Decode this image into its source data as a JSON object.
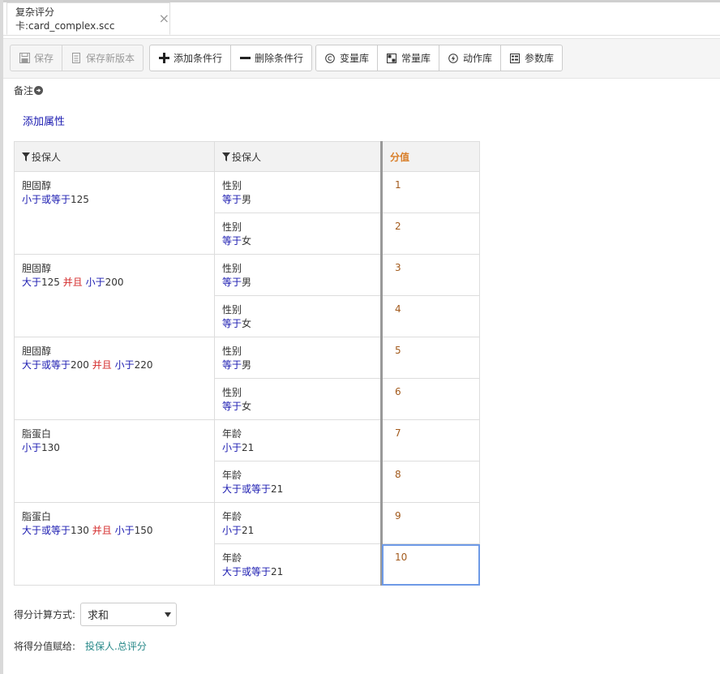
{
  "tab": {
    "title": "复杂评分卡:card_complex.scc",
    "close_glyph": "×"
  },
  "toolbar": {
    "groups": [
      [
        {
          "label": "保存",
          "icon": "save-icon",
          "disabled": true
        },
        {
          "label": "保存新版本",
          "icon": "save-new-version-icon",
          "disabled": true
        }
      ],
      [
        {
          "label": "添加条件行",
          "icon": "plus-icon",
          "disabled": false
        },
        {
          "label": "删除条件行",
          "icon": "minus-icon",
          "disabled": false
        }
      ],
      [
        {
          "label": "变量库",
          "icon": "copyright-icon",
          "disabled": false
        },
        {
          "label": "常量库",
          "icon": "grid-icon",
          "disabled": false
        },
        {
          "label": "动作库",
          "icon": "bolt-icon",
          "disabled": false
        },
        {
          "label": "参数库",
          "icon": "list-icon",
          "disabled": false
        }
      ]
    ]
  },
  "note": {
    "label": "备注"
  },
  "add_attribute": {
    "label": "添加属性"
  },
  "table": {
    "headers": [
      "投保人",
      "投保人",
      "分值"
    ],
    "groups": [
      {
        "attribute": "胆固醇",
        "condition": [
          {
            "t": "op",
            "v": "小于或等于"
          },
          {
            "t": "num",
            "v": "125"
          }
        ],
        "rows": [
          {
            "attribute": "性别",
            "condition": [
              {
                "t": "op",
                "v": "等于"
              },
              {
                "t": "num",
                "v": "男"
              }
            ],
            "score": "1"
          },
          {
            "attribute": "性别",
            "condition": [
              {
                "t": "op",
                "v": "等于"
              },
              {
                "t": "num",
                "v": "女"
              }
            ],
            "score": "2"
          }
        ]
      },
      {
        "attribute": "胆固醇",
        "condition": [
          {
            "t": "op",
            "v": "大于"
          },
          {
            "t": "num",
            "v": "125 "
          },
          {
            "t": "and",
            "v": "并且 "
          },
          {
            "t": "op",
            "v": "小于"
          },
          {
            "t": "num",
            "v": "200"
          }
        ],
        "rows": [
          {
            "attribute": "性别",
            "condition": [
              {
                "t": "op",
                "v": "等于"
              },
              {
                "t": "num",
                "v": "男"
              }
            ],
            "score": "3"
          },
          {
            "attribute": "性别",
            "condition": [
              {
                "t": "op",
                "v": "等于"
              },
              {
                "t": "num",
                "v": "女"
              }
            ],
            "score": "4"
          }
        ]
      },
      {
        "attribute": "胆固醇",
        "condition": [
          {
            "t": "op",
            "v": "大于或等于"
          },
          {
            "t": "num",
            "v": "200 "
          },
          {
            "t": "and",
            "v": "并且 "
          },
          {
            "t": "op",
            "v": "小于"
          },
          {
            "t": "num",
            "v": "220"
          }
        ],
        "rows": [
          {
            "attribute": "性别",
            "condition": [
              {
                "t": "op",
                "v": "等于"
              },
              {
                "t": "num",
                "v": "男"
              }
            ],
            "score": "5"
          },
          {
            "attribute": "性别",
            "condition": [
              {
                "t": "op",
                "v": "等于"
              },
              {
                "t": "num",
                "v": "女"
              }
            ],
            "score": "6"
          }
        ]
      },
      {
        "attribute": "脂蛋白",
        "condition": [
          {
            "t": "op",
            "v": "小于"
          },
          {
            "t": "num",
            "v": "130"
          }
        ],
        "rows": [
          {
            "attribute": "年龄",
            "condition": [
              {
                "t": "op",
                "v": "小于"
              },
              {
                "t": "num",
                "v": "21"
              }
            ],
            "score": "7"
          },
          {
            "attribute": "年龄",
            "condition": [
              {
                "t": "op",
                "v": "大于或等于"
              },
              {
                "t": "num",
                "v": "21"
              }
            ],
            "score": "8"
          }
        ]
      },
      {
        "attribute": "脂蛋白",
        "condition": [
          {
            "t": "op",
            "v": "大于或等于"
          },
          {
            "t": "num",
            "v": "130 "
          },
          {
            "t": "and",
            "v": "并且 "
          },
          {
            "t": "op",
            "v": "小于"
          },
          {
            "t": "num",
            "v": "150"
          }
        ],
        "rows": [
          {
            "attribute": "年龄",
            "condition": [
              {
                "t": "op",
                "v": "小于"
              },
              {
                "t": "num",
                "v": "21"
              }
            ],
            "score": "9"
          },
          {
            "attribute": "年龄",
            "condition": [
              {
                "t": "op",
                "v": "大于或等于"
              },
              {
                "t": "num",
                "v": "21"
              }
            ],
            "score": "10",
            "selected": true
          }
        ]
      }
    ]
  },
  "score_calc": {
    "label": "得分计算方式:",
    "value": "求和"
  },
  "assign": {
    "label": "将得分值赋给:",
    "target": "投保人.总评分"
  },
  "colors": {
    "operator": "#1a1ab0",
    "and": "#d42b2b",
    "score_header": "#d97f2a",
    "score_value": "#a25a1c",
    "link": "#2a8a8a",
    "selection": "#6e9ae6"
  }
}
